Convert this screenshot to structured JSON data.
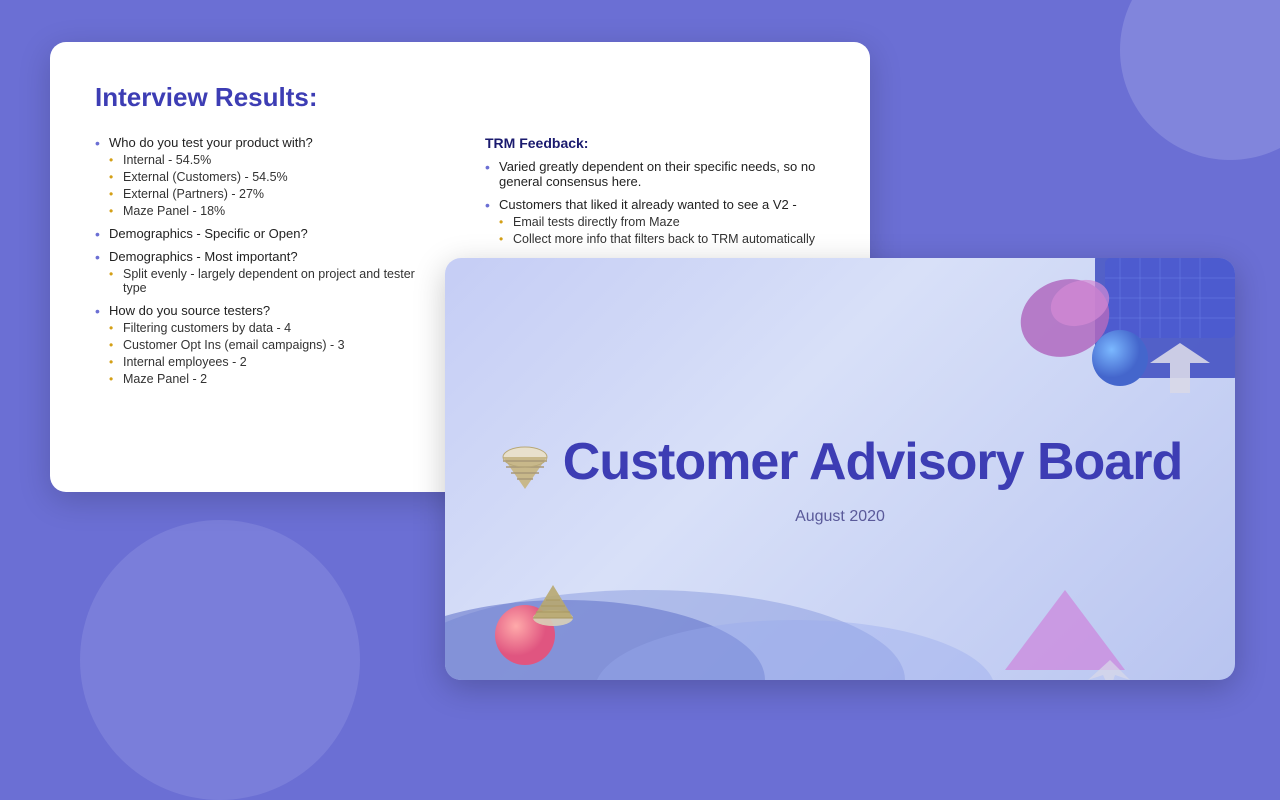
{
  "background": {
    "color": "#6b6fd4"
  },
  "left_slide": {
    "title": "Interview Results:",
    "left_column": {
      "items": [
        {
          "text": "Who do you test your product with?",
          "sub_items": [
            "Internal - 54.5%",
            "External (Customers) - 54.5%",
            "External (Partners) - 27%",
            "Maze Panel - 18%"
          ]
        },
        {
          "text": "Demographics - Specific or Open?"
        },
        {
          "text": "Demographics - Most important?",
          "sub_items": [
            "Split evenly - largely dependent on project and tester type"
          ]
        },
        {
          "text": "How do you source testers?",
          "sub_items": [
            "Filtering customers by data - 4",
            "Customer Opt Ins (email campaigns) - 3",
            "Internal employees - 2",
            "Maze Panel - 2"
          ]
        }
      ]
    },
    "right_column": {
      "title": "TRM Feedback:",
      "items": [
        {
          "text": "Varied greatly dependent on their specific needs, so no general consensus here."
        },
        {
          "text": "Customers that liked it already wanted to see a V2 -",
          "sub_items": [
            "Email tests directly from Maze",
            "Collect more info that filters back to TRM automatically"
          ]
        }
      ]
    }
  },
  "right_slide": {
    "title": "Customer Advisory Board",
    "subtitle": "August 2020"
  }
}
